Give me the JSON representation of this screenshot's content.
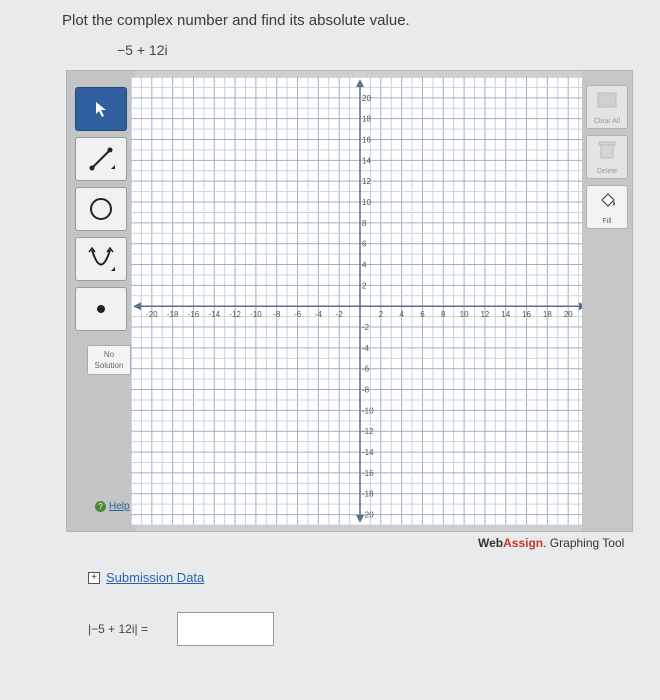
{
  "question": "Plot the complex number and find its absolute value.",
  "expression": "−5 + 12i",
  "toolbar": {
    "tools": [
      {
        "name": "pointer-tool",
        "icon": "pointer-arrow-icon"
      },
      {
        "name": "line-tool",
        "icon": "line-segment-icon"
      },
      {
        "name": "circle-tool",
        "icon": "circle-icon"
      },
      {
        "name": "parabola-tool",
        "icon": "parabola-icon"
      },
      {
        "name": "point-tool",
        "icon": "point-icon"
      }
    ],
    "no_solution_line1": "No",
    "no_solution_line2": "Solution",
    "help_label": "Help"
  },
  "rightbar": {
    "clear_label": "Clear All",
    "delete_label": "Delete",
    "fill_label": "Fill"
  },
  "graph": {
    "x_ticks": [
      "-20",
      "-18",
      "-16",
      "-14",
      "-12",
      "-10",
      "-8",
      "-6",
      "-4",
      "-2",
      "2",
      "4",
      "6",
      "8",
      "10",
      "12",
      "14",
      "16",
      "18",
      "20"
    ],
    "y_ticks_pos": [
      "20",
      "18",
      "16",
      "14",
      "12",
      "10",
      "8",
      "6",
      "4",
      "2"
    ],
    "y_ticks_neg": [
      "-2",
      "-4",
      "-6",
      "-8",
      "-10",
      "-12",
      "-14",
      "-16",
      "-18",
      "-20"
    ],
    "xlim": [
      -22,
      22
    ],
    "ylim": [
      -21,
      22
    ]
  },
  "brand": {
    "web": "Web",
    "assign": "Assign",
    "suffix": ". Graphing Tool"
  },
  "submission_label": "Submission Data",
  "absolute_value_label": "|−5 + 12i| =",
  "answer_value": ""
}
